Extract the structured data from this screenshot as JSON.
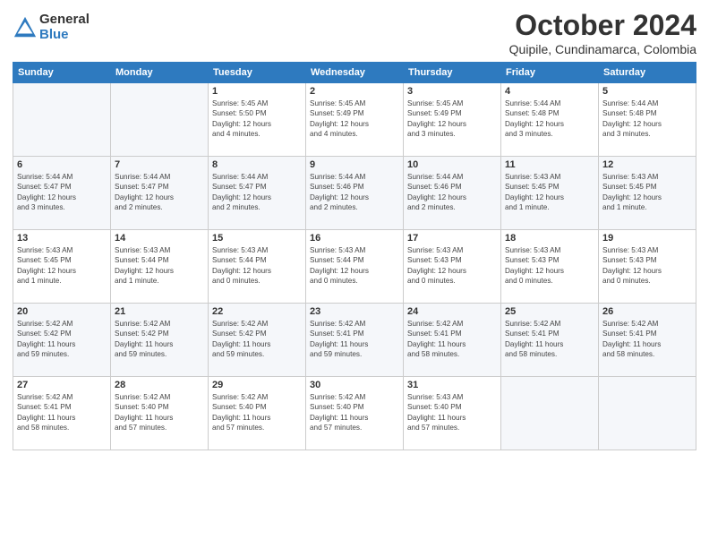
{
  "header": {
    "logo": {
      "general": "General",
      "blue": "Blue"
    },
    "title": "October 2024",
    "location": "Quipile, Cundinamarca, Colombia"
  },
  "weekdays": [
    "Sunday",
    "Monday",
    "Tuesday",
    "Wednesday",
    "Thursday",
    "Friday",
    "Saturday"
  ],
  "weeks": [
    [
      {
        "day": "",
        "info": ""
      },
      {
        "day": "",
        "info": ""
      },
      {
        "day": "1",
        "info": "Sunrise: 5:45 AM\nSunset: 5:50 PM\nDaylight: 12 hours\nand 4 minutes."
      },
      {
        "day": "2",
        "info": "Sunrise: 5:45 AM\nSunset: 5:49 PM\nDaylight: 12 hours\nand 4 minutes."
      },
      {
        "day": "3",
        "info": "Sunrise: 5:45 AM\nSunset: 5:49 PM\nDaylight: 12 hours\nand 3 minutes."
      },
      {
        "day": "4",
        "info": "Sunrise: 5:44 AM\nSunset: 5:48 PM\nDaylight: 12 hours\nand 3 minutes."
      },
      {
        "day": "5",
        "info": "Sunrise: 5:44 AM\nSunset: 5:48 PM\nDaylight: 12 hours\nand 3 minutes."
      }
    ],
    [
      {
        "day": "6",
        "info": "Sunrise: 5:44 AM\nSunset: 5:47 PM\nDaylight: 12 hours\nand 3 minutes."
      },
      {
        "day": "7",
        "info": "Sunrise: 5:44 AM\nSunset: 5:47 PM\nDaylight: 12 hours\nand 2 minutes."
      },
      {
        "day": "8",
        "info": "Sunrise: 5:44 AM\nSunset: 5:47 PM\nDaylight: 12 hours\nand 2 minutes."
      },
      {
        "day": "9",
        "info": "Sunrise: 5:44 AM\nSunset: 5:46 PM\nDaylight: 12 hours\nand 2 minutes."
      },
      {
        "day": "10",
        "info": "Sunrise: 5:44 AM\nSunset: 5:46 PM\nDaylight: 12 hours\nand 2 minutes."
      },
      {
        "day": "11",
        "info": "Sunrise: 5:43 AM\nSunset: 5:45 PM\nDaylight: 12 hours\nand 1 minute."
      },
      {
        "day": "12",
        "info": "Sunrise: 5:43 AM\nSunset: 5:45 PM\nDaylight: 12 hours\nand 1 minute."
      }
    ],
    [
      {
        "day": "13",
        "info": "Sunrise: 5:43 AM\nSunset: 5:45 PM\nDaylight: 12 hours\nand 1 minute."
      },
      {
        "day": "14",
        "info": "Sunrise: 5:43 AM\nSunset: 5:44 PM\nDaylight: 12 hours\nand 1 minute."
      },
      {
        "day": "15",
        "info": "Sunrise: 5:43 AM\nSunset: 5:44 PM\nDaylight: 12 hours\nand 0 minutes."
      },
      {
        "day": "16",
        "info": "Sunrise: 5:43 AM\nSunset: 5:44 PM\nDaylight: 12 hours\nand 0 minutes."
      },
      {
        "day": "17",
        "info": "Sunrise: 5:43 AM\nSunset: 5:43 PM\nDaylight: 12 hours\nand 0 minutes."
      },
      {
        "day": "18",
        "info": "Sunrise: 5:43 AM\nSunset: 5:43 PM\nDaylight: 12 hours\nand 0 minutes."
      },
      {
        "day": "19",
        "info": "Sunrise: 5:43 AM\nSunset: 5:43 PM\nDaylight: 12 hours\nand 0 minutes."
      }
    ],
    [
      {
        "day": "20",
        "info": "Sunrise: 5:42 AM\nSunset: 5:42 PM\nDaylight: 11 hours\nand 59 minutes."
      },
      {
        "day": "21",
        "info": "Sunrise: 5:42 AM\nSunset: 5:42 PM\nDaylight: 11 hours\nand 59 minutes."
      },
      {
        "day": "22",
        "info": "Sunrise: 5:42 AM\nSunset: 5:42 PM\nDaylight: 11 hours\nand 59 minutes."
      },
      {
        "day": "23",
        "info": "Sunrise: 5:42 AM\nSunset: 5:41 PM\nDaylight: 11 hours\nand 59 minutes."
      },
      {
        "day": "24",
        "info": "Sunrise: 5:42 AM\nSunset: 5:41 PM\nDaylight: 11 hours\nand 58 minutes."
      },
      {
        "day": "25",
        "info": "Sunrise: 5:42 AM\nSunset: 5:41 PM\nDaylight: 11 hours\nand 58 minutes."
      },
      {
        "day": "26",
        "info": "Sunrise: 5:42 AM\nSunset: 5:41 PM\nDaylight: 11 hours\nand 58 minutes."
      }
    ],
    [
      {
        "day": "27",
        "info": "Sunrise: 5:42 AM\nSunset: 5:41 PM\nDaylight: 11 hours\nand 58 minutes."
      },
      {
        "day": "28",
        "info": "Sunrise: 5:42 AM\nSunset: 5:40 PM\nDaylight: 11 hours\nand 57 minutes."
      },
      {
        "day": "29",
        "info": "Sunrise: 5:42 AM\nSunset: 5:40 PM\nDaylight: 11 hours\nand 57 minutes."
      },
      {
        "day": "30",
        "info": "Sunrise: 5:42 AM\nSunset: 5:40 PM\nDaylight: 11 hours\nand 57 minutes."
      },
      {
        "day": "31",
        "info": "Sunrise: 5:43 AM\nSunset: 5:40 PM\nDaylight: 11 hours\nand 57 minutes."
      },
      {
        "day": "",
        "info": ""
      },
      {
        "day": "",
        "info": ""
      }
    ]
  ]
}
